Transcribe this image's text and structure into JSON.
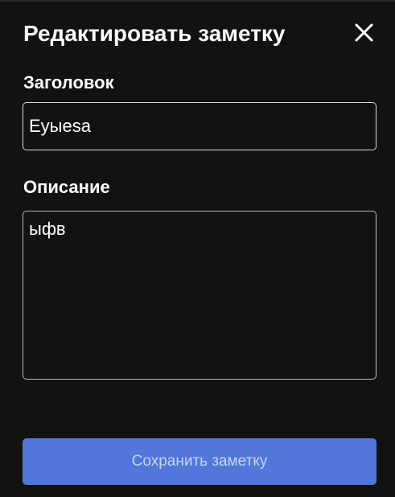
{
  "modal": {
    "title": "Редактировать заметку",
    "close_icon": "close-icon"
  },
  "form": {
    "title_label": "Заголовок",
    "title_value": "Eyыesa",
    "description_label": "Описание",
    "description_value": "ыфв",
    "save_label": "Сохранить заметку"
  },
  "colors": {
    "background": "#121212",
    "accent": "#5077d9",
    "button_text": "#c7d5f3",
    "text": "#ffffff",
    "border": "#d9d9d9"
  }
}
